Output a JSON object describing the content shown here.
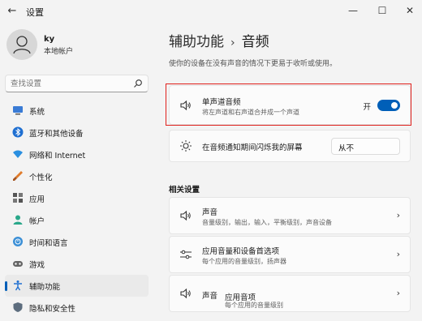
{
  "window": {
    "title": "设置",
    "back_icon": "←",
    "minimize_icon": "—",
    "maximize_icon": "☐",
    "close_icon": "✕"
  },
  "profile": {
    "name": "ky",
    "account_type": "本地帐户"
  },
  "search": {
    "placeholder": "查找设置"
  },
  "sidebar": {
    "items": [
      {
        "label": "系统",
        "icon": "monitor-icon"
      },
      {
        "label": "蓝牙和其他设备",
        "icon": "bluetooth-icon"
      },
      {
        "label": "网络和 Internet",
        "icon": "wifi-icon"
      },
      {
        "label": "个性化",
        "icon": "brush-icon"
      },
      {
        "label": "应用",
        "icon": "apps-icon"
      },
      {
        "label": "帐户",
        "icon": "person-icon"
      },
      {
        "label": "时间和语言",
        "icon": "globe-clock-icon"
      },
      {
        "label": "游戏",
        "icon": "gamepad-icon"
      },
      {
        "label": "辅助功能",
        "icon": "accessibility-icon",
        "active": true
      },
      {
        "label": "隐私和安全性",
        "icon": "shield-icon"
      }
    ]
  },
  "breadcrumb": {
    "parent": "辅助功能",
    "separator": "›",
    "current": "音频"
  },
  "description": "使你的设备在没有声音的情况下更易于收听或使用。",
  "settings": {
    "mono_audio": {
      "title": "单声道音频",
      "subtitle": "将左声道和右声道合并成一个声道",
      "state_label": "开",
      "on": true
    },
    "flash_screen": {
      "title": "在音频通知期间闪烁我的屏幕",
      "selected": "从不"
    }
  },
  "related": {
    "heading": "相关设置",
    "items": [
      {
        "title": "声音",
        "subtitle": "音量级别，输出，输入，平衡级别，声音设备"
      },
      {
        "title": "应用音量和设备首选项",
        "subtitle": "每个应用的音量级别，扬声器"
      },
      {
        "title": "声音",
        "title2": "应用音项",
        "subtitle": "每个应用的音量级别"
      }
    ]
  },
  "colors": {
    "accent": "#005fb8",
    "highlight_border": "#e0201c"
  }
}
